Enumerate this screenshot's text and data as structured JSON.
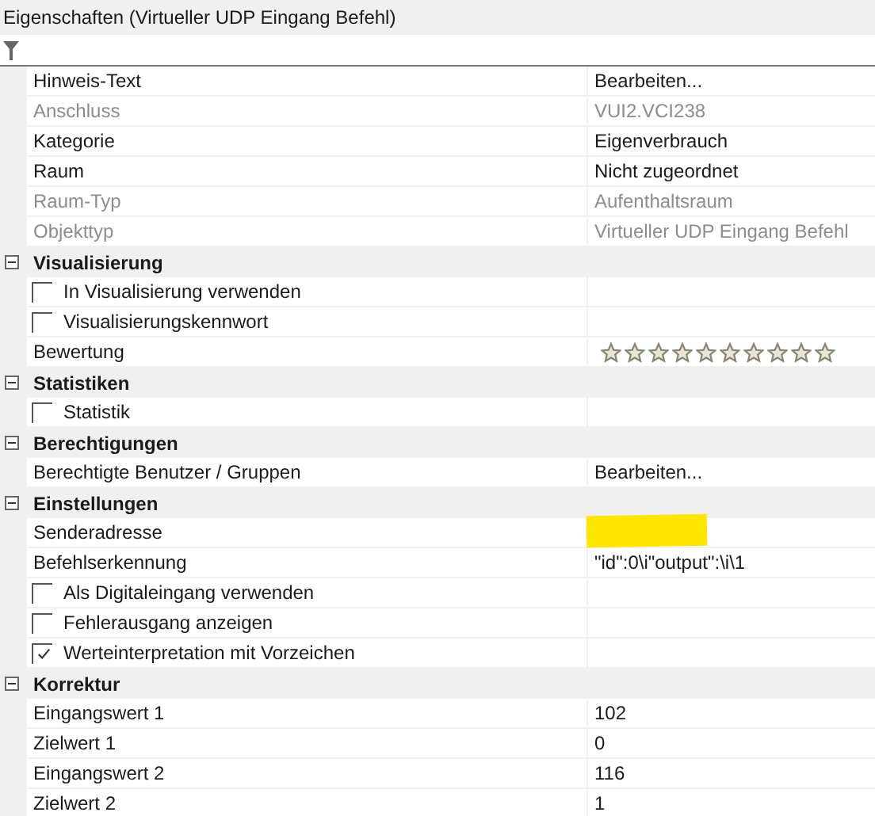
{
  "panel": {
    "title": "Eigenschaften (Virtueller UDP Eingang Befehl)"
  },
  "groups": [
    {
      "rows": [
        {
          "kind": "text",
          "name": "Hinweis-Text",
          "value": "Bearbeiten...",
          "disabled": false
        },
        {
          "kind": "text",
          "name": "Anschluss",
          "value": "VUI2.VCI238",
          "disabled": true
        },
        {
          "kind": "text",
          "name": "Kategorie",
          "value": "Eigenverbrauch",
          "disabled": false
        },
        {
          "kind": "text",
          "name": "Raum",
          "value": "Nicht zugeordnet",
          "disabled": false
        },
        {
          "kind": "text",
          "name": "Raum-Typ",
          "value": "Aufenthaltsraum",
          "disabled": true
        },
        {
          "kind": "text",
          "name": "Objekttyp",
          "value": "Virtueller UDP Eingang Befehl",
          "disabled": true
        }
      ]
    },
    {
      "title": "Visualisierung",
      "expanded": true,
      "rows": [
        {
          "kind": "check",
          "name": "In Visualisierung verwenden",
          "checked": false,
          "disabled": false
        },
        {
          "kind": "check",
          "name": "Visualisierungskennwort",
          "checked": false,
          "disabled": false
        },
        {
          "kind": "rating",
          "name": "Bewertung",
          "stars": 0,
          "disabled": false
        }
      ]
    },
    {
      "title": "Statistiken",
      "expanded": true,
      "rows": [
        {
          "kind": "check",
          "name": "Statistik",
          "checked": false,
          "disabled": false
        }
      ]
    },
    {
      "title": "Berechtigungen",
      "expanded": true,
      "rows": [
        {
          "kind": "text",
          "name": "Berechtigte Benutzer / Gruppen",
          "value": "Bearbeiten...",
          "disabled": false
        }
      ]
    },
    {
      "title": "Einstellungen",
      "expanded": true,
      "rows": [
        {
          "kind": "redacted",
          "name": "Senderadresse",
          "disabled": false
        },
        {
          "kind": "text",
          "name": "Befehlserkennung",
          "value": "\"id\":0\\i\"output\":\\i\\1",
          "disabled": false
        },
        {
          "kind": "check",
          "name": "Als Digitaleingang verwenden",
          "checked": false,
          "disabled": false
        },
        {
          "kind": "check",
          "name": "Fehlerausgang anzeigen",
          "checked": false,
          "disabled": false
        },
        {
          "kind": "check",
          "name": "Werteinterpretation mit Vorzeichen",
          "checked": true,
          "disabled": false
        }
      ]
    },
    {
      "title": "Korrektur",
      "expanded": true,
      "rows": [
        {
          "kind": "text",
          "name": "Eingangswert 1",
          "value": "102",
          "disabled": false
        },
        {
          "kind": "text",
          "name": "Zielwert 1",
          "value": "0",
          "disabled": false
        },
        {
          "kind": "text",
          "name": "Eingangswert 2",
          "value": "116",
          "disabled": false
        },
        {
          "kind": "text",
          "name": "Zielwert 2",
          "value": "1",
          "disabled": false
        }
      ]
    }
  ]
}
